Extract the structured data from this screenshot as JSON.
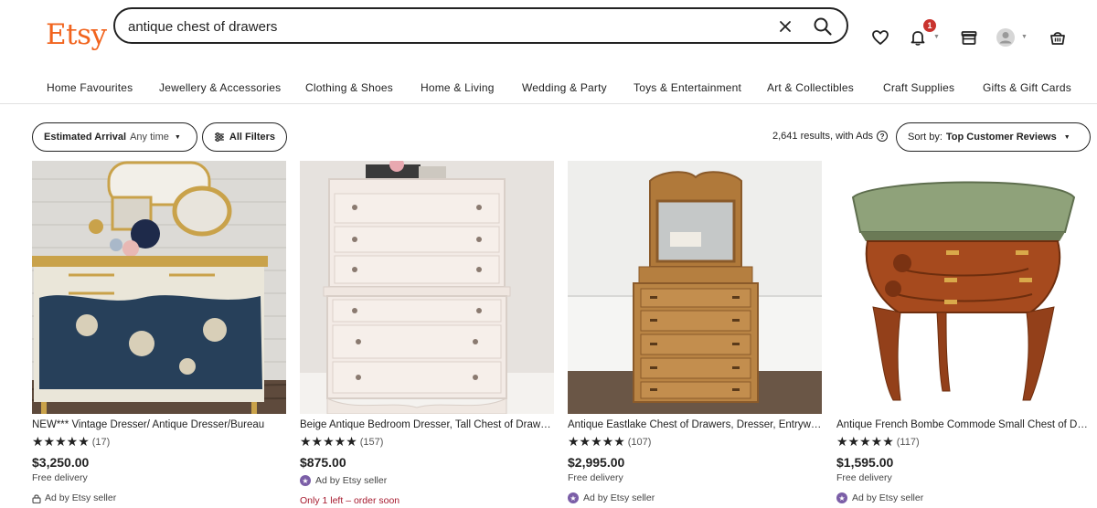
{
  "header": {
    "logo": "Etsy",
    "search_value": "antique chest of drawers",
    "notification_count": "1"
  },
  "categories": [
    "Home Favourites",
    "Jewellery & Accessories",
    "Clothing & Shoes",
    "Home & Living",
    "Wedding & Party",
    "Toys & Entertainment",
    "Art & Collectibles",
    "Craft Supplies",
    "Gifts & Gift Cards"
  ],
  "filters": {
    "arrival_label": "Estimated Arrival",
    "arrival_value": "Any time",
    "all_filters": "All Filters",
    "results": "2,641 results, with Ads",
    "sort_label": "Sort by:",
    "sort_value": "Top Customer Reviews"
  },
  "listings": [
    {
      "title": "NEW*** Vintage Dresser/ Antique Dresser/Bureau",
      "stars": "★★★★★",
      "reviews": "(17)",
      "price": "$3,250.00",
      "delivery": "Free delivery",
      "ad": "Ad by Etsy seller",
      "stock": ""
    },
    {
      "title": "Beige Antique Bedroom Dresser, Tall Chest of Drawers",
      "stars": "★★★★★",
      "reviews": "(157)",
      "price": "$875.00",
      "delivery": "",
      "ad": "Ad by Etsy seller",
      "stock": "Only 1 left – order soon"
    },
    {
      "title": "Antique Eastlake Chest of Drawers, Dresser, Entryway",
      "stars": "★★★★★",
      "reviews": "(107)",
      "price": "$2,995.00",
      "delivery": "Free delivery",
      "ad": "Ad by Etsy seller",
      "stock": ""
    },
    {
      "title": "Antique French Bombe Commode Small Chest of Drawers",
      "stars": "★★★★★",
      "reviews": "(117)",
      "price": "$1,595.00",
      "delivery": "Free delivery",
      "ad": "Ad by Etsy seller",
      "stock": ""
    }
  ],
  "colors": {
    "brand": "#f1641e",
    "badge": "#c9332e",
    "ad_purple": "#7b5ea7",
    "stock_red": "#a61a2e"
  },
  "icons": [
    "clear-icon",
    "search-icon",
    "heart-icon",
    "bell-icon",
    "gift-icon",
    "avatar",
    "cart-icon",
    "filter-icon",
    "help-icon",
    "star-icon"
  ]
}
